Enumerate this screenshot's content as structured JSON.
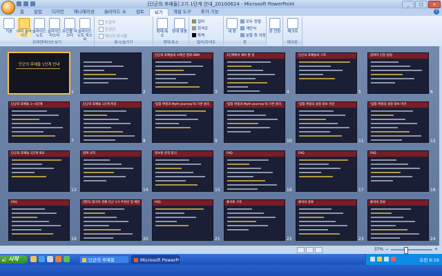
{
  "window": {
    "title": "[단군의 후예들] 2기 1단계 안내_20100624 - Microsoft PowerPoint",
    "ctl_min": "_",
    "ctl_max": "□",
    "ctl_close": "x"
  },
  "ribbon": {
    "tabs": [
      {
        "label": "홈"
      },
      {
        "label": "삽입"
      },
      {
        "label": "디자인"
      },
      {
        "label": "애니메이션"
      },
      {
        "label": "슬라이드 쇼"
      },
      {
        "label": "검토"
      },
      {
        "label": "보기"
      },
      {
        "label": "개발 도구"
      },
      {
        "label": "추가 기능"
      }
    ],
    "active_tab": "보기",
    "groups": {
      "views": {
        "label": "프레젠테이션 보기",
        "buttons": [
          "기본",
          "여러 슬라이드",
          "슬라이드 노트",
          "슬라이드 마스터",
          "유인물 마스터",
          "슬라이드 노트 마스터"
        ]
      },
      "show_hide": {
        "label": "표시/숨기기",
        "items": [
          "눈금자",
          "눈금선",
          "메시지 표시줄"
        ]
      },
      "zoom": {
        "label": "확대/축소",
        "buttons": [
          "확대/축소",
          "창에 맞춤"
        ]
      },
      "color": {
        "label": "컬러/회색조",
        "items": [
          "컬러",
          "회색조",
          "흑백"
        ]
      },
      "window": {
        "label": "창",
        "buttons": [
          "새 창"
        ],
        "items": [
          "모두 정렬",
          "계단식",
          "분할 창 이동"
        ],
        "switch_label": "창 전환"
      },
      "macro": {
        "label": "매크로",
        "buttons": [
          "매크로"
        ]
      }
    }
  },
  "slides": [
    {
      "num": "1",
      "title": "단군의 후예들 1단계 안내"
    },
    {
      "num": "2",
      "title": ""
    },
    {
      "num": "3",
      "title": "단군의 후예들의 브레인 맵과 DNA"
    },
    {
      "num": "4",
      "title": "1단계에서 해야 할 일"
    },
    {
      "num": "5",
      "title": "단군의 후예들의 구조"
    },
    {
      "num": "6",
      "title": "참여자 인증 방법"
    },
    {
      "num": "7",
      "title": "단군의 후예들 1~3단계"
    },
    {
      "num": "8",
      "title": "단군의 후예들 1단계 특징"
    },
    {
      "num": "9",
      "title": "'탐험 여정과 Myth Journey'의 기본 원리"
    },
    {
      "num": "10",
      "title": "'탐험 여정과 Myth Journey'의 기본 원리"
    },
    {
      "num": "11",
      "title": "'탐험 여정의 설정 정보 미션"
    },
    {
      "num": "12",
      "title": "'탐험 여정의 설정 정보 미션"
    },
    {
      "num": "13",
      "title": "단군의 후예들 1단계 개요"
    },
    {
      "num": "14",
      "title": "참여 규칙"
    },
    {
      "num": "15",
      "title": "정보원 운영 방식"
    },
    {
      "num": "16",
      "title": "FAQ"
    },
    {
      "num": "17",
      "title": "FAQ"
    },
    {
      "num": "18",
      "title": "FAQ"
    },
    {
      "num": "19",
      "title": "FAQ"
    },
    {
      "num": "20",
      "title": "[별지] 참가자 현황 단군 1기 추천인 및 배분"
    },
    {
      "num": "21",
      "title": "FAQ"
    },
    {
      "num": "22",
      "title": "출석표 구조"
    },
    {
      "num": "23",
      "title": "출석의 종류"
    },
    {
      "num": "24",
      "title": "출석의 종류"
    }
  ],
  "statusbar": {
    "zoom": "37%"
  },
  "taskbar": {
    "start": "시작",
    "buttons": [
      "단군의 후예들",
      "Microsoft PowerPoint ..."
    ],
    "clock": "오전 6:16"
  },
  "colors": {
    "slide_bg": "#1a1f35",
    "slide_header": "#7a1d26",
    "sorter_bg": "#6a81a6",
    "taskbar": "#1e56c2"
  }
}
